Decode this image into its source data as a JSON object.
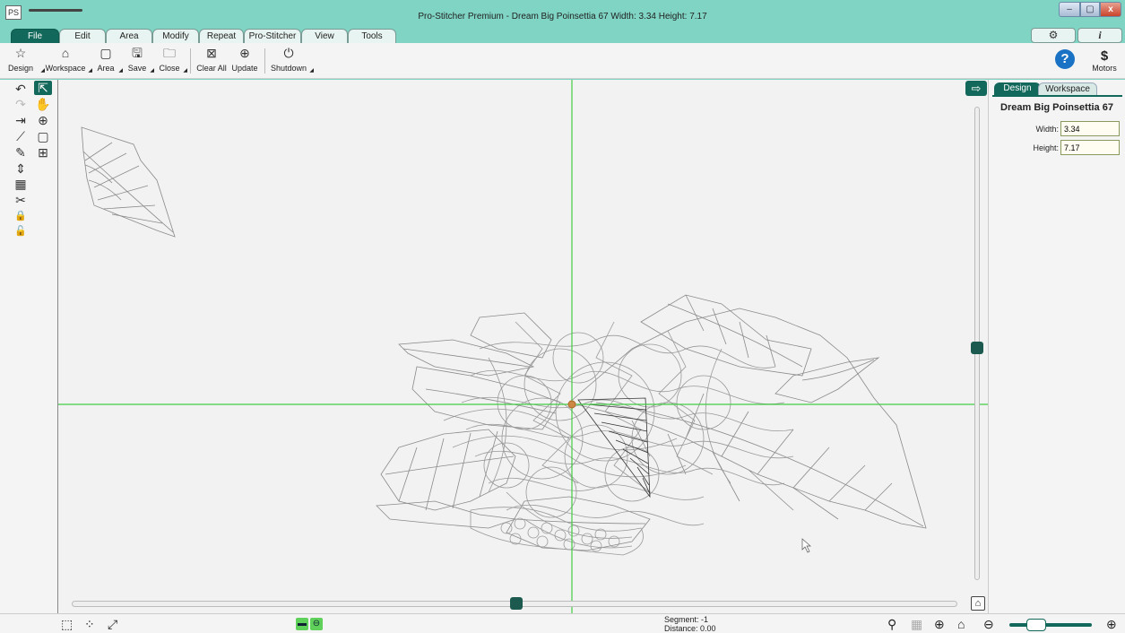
{
  "window": {
    "title": "Pro-Stitcher Premium  -  Dream Big Poinsettia 67  Width: 3.34  Height: 7.17",
    "app_icon": "PS",
    "min": "–",
    "max": "▢",
    "close": "x"
  },
  "menu": {
    "tabs": [
      {
        "label": "File",
        "active": true
      },
      {
        "label": "Edit"
      },
      {
        "label": "Area"
      },
      {
        "label": "Modify"
      },
      {
        "label": "Repeat"
      },
      {
        "label": "Pro-Stitcher"
      },
      {
        "label": "View"
      },
      {
        "label": "Tools"
      }
    ],
    "settings_icon": "⚙",
    "info_icon": "i"
  },
  "toolbar": {
    "design": {
      "label": "Design",
      "icon": "☆"
    },
    "workspace": {
      "label": "Workspace",
      "icon": "⌂"
    },
    "area": {
      "label": "Area",
      "icon": "▢"
    },
    "save": {
      "label": "Save",
      "icon": "🖫"
    },
    "close": {
      "label": "Close",
      "icon": "🗀"
    },
    "clear_all": {
      "label": "Clear All",
      "icon": "⊠"
    },
    "update": {
      "label": "Update",
      "icon": "⊕"
    },
    "shutdown": {
      "label": "Shutdown",
      "icon": "⏻"
    },
    "help": "?",
    "motors": {
      "label": "Motors",
      "icon": "$"
    }
  },
  "left_tools": {
    "undo": "↶",
    "select": "⇱",
    "redo": "↷",
    "pan": "✋",
    "measure": "⇥",
    "zoom": "⊕",
    "ruler": "⟋",
    "box": "▢",
    "node": "✎",
    "grid": "⊞",
    "align": "⇕",
    "pattern": "▦",
    "stitch": "✂",
    "lock": "🔒",
    "unlock": "🔓"
  },
  "canvas": {
    "panel_toggle": "⇨",
    "home": "⌂",
    "crosshair_color": "#44cc44",
    "design_color": "#8a8a8a"
  },
  "right_panel": {
    "tabs": [
      "Design",
      "Workspace"
    ],
    "design_name": "Dream Big Poinsettia 67",
    "width_label": "Width:",
    "width_value": "3.34",
    "height_label": "Height:",
    "height_value": "7.17"
  },
  "status": {
    "segment": "Segment: -1",
    "distance": "Distance: 0.00",
    "icons": {
      "select_box": "⬚",
      "nodes": "⁘",
      "arrows": "⤢",
      "mode_a": "▬",
      "mode_b": "⊖",
      "trace": "⚲",
      "photo": "▦",
      "zoom_fit": "⊕",
      "home": "⌂",
      "zoom_out": "⊖",
      "zoom_in": "⊕"
    },
    "zoom_level": 0.3
  }
}
